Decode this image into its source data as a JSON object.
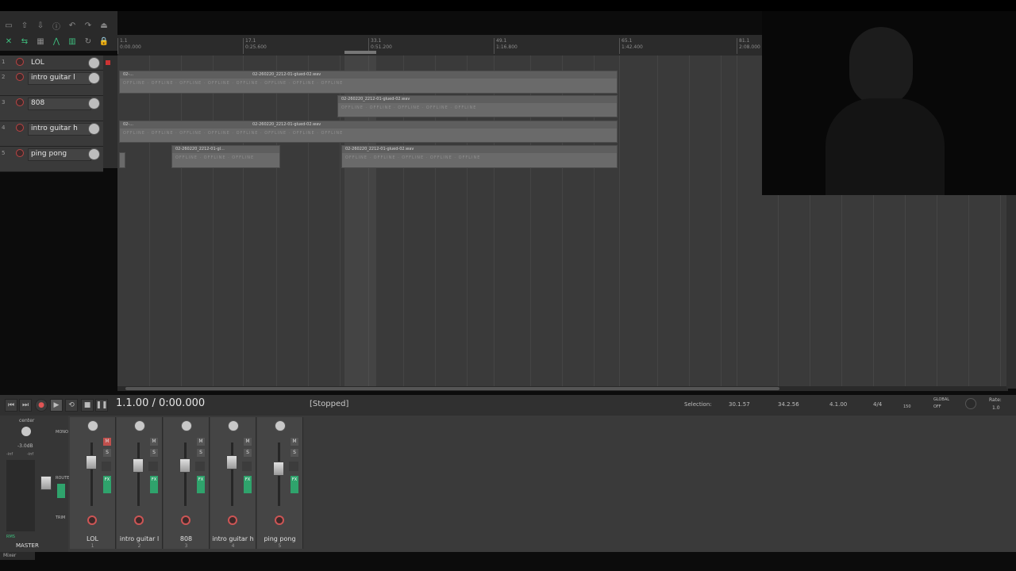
{
  "toolbar": {
    "row1_icons": [
      "new-project-icon",
      "open-project-icon",
      "save-project-icon",
      "project-settings-icon",
      "undo-icon",
      "redo-icon",
      "metronome-icon"
    ],
    "row2_icons": [
      "grid-icon",
      "ripple-icon",
      "snap-icon",
      "item-lock-icon",
      "loop-icon",
      "lock-icon"
    ]
  },
  "ruler": {
    "markers": [
      {
        "bar": "1.1",
        "time": "0:00.000"
      },
      {
        "bar": "17.1",
        "time": "0:25.600"
      },
      {
        "bar": "33.1",
        "time": "0:51.200"
      },
      {
        "bar": "49.1",
        "time": "1:16.800"
      },
      {
        "bar": "65.1",
        "time": "1:42.400"
      },
      {
        "bar": "81.1",
        "time": "2:08.000"
      }
    ]
  },
  "tracks": [
    {
      "num": "1",
      "name": "LOL"
    },
    {
      "num": "2",
      "name": "intro guitar l"
    },
    {
      "num": "3",
      "name": "808"
    },
    {
      "num": "4",
      "name": "intro guitar h"
    },
    {
      "num": "5",
      "name": "ping pong"
    }
  ],
  "items": {
    "offline_text": "OFFLINE",
    "glued_short": "02-...",
    "glued_wav": "02-260220_2212-01-glued-02.wav",
    "glued_trunc": "02-260220_2212-01-gl..."
  },
  "transport": {
    "clock": "1.1.00 / 0:00.000",
    "status": "[Stopped]",
    "selection_label": "Selection:",
    "sel_start": "30.1.57",
    "sel_end": "34.2.56",
    "sel_len": "4.1.00",
    "time_sig": "4/4",
    "bpm": "150",
    "global_label": "GLOBAL",
    "global_state": "OFF",
    "rate_label": "Rate:",
    "rate_value": "1.0"
  },
  "master": {
    "pan": "center",
    "db": "-3.0dB",
    "peak_l": "-inf",
    "peak_r": "-inf",
    "mono": "MONO",
    "route": "ROUTE",
    "trim": "TRIM",
    "rms": "RMS",
    "name": "MASTER"
  },
  "mixer_strips": [
    {
      "name": "LOL",
      "num": "1",
      "muted": true
    },
    {
      "name": "intro guitar l",
      "num": "2",
      "muted": false
    },
    {
      "name": "808",
      "num": "3",
      "muted": false
    },
    {
      "name": "intro guitar h",
      "num": "4",
      "muted": false
    },
    {
      "name": "ping pong",
      "num": "5",
      "muted": false
    }
  ],
  "mixer_tab": "Mixer",
  "colors": {
    "accent_green": "#3fbf7f",
    "record_red": "#c55555",
    "fx_green": "#2fa36c"
  }
}
